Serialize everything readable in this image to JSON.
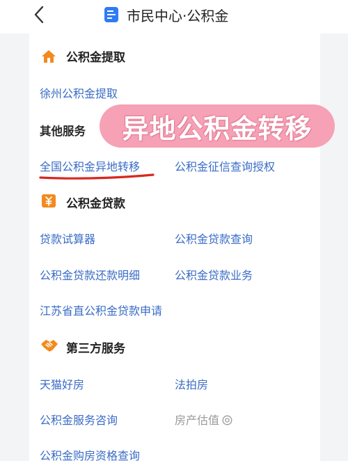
{
  "header": {
    "title": "市民中心·公积金",
    "back_icon": "chevron-left-icon",
    "app_icon": "document-icon"
  },
  "sections": {
    "withdraw": {
      "title": "公积金提取",
      "icon": "house-icon",
      "items": [
        "徐州公积金提取"
      ]
    },
    "other": {
      "title": "其他服务",
      "items": [
        "全国公积金异地转移",
        "公积金征信查询授权"
      ]
    },
    "loan": {
      "title": "公积金贷款",
      "icon": "money-icon",
      "items": [
        "贷款试算器",
        "公积金贷款查询",
        "公积金贷款还款明细",
        "公积金贷款业务",
        "江苏省直公积金贷款申请"
      ]
    },
    "third": {
      "title": "第三方服务",
      "icon": "handshake-icon",
      "items": [
        "天猫好房",
        "法拍房",
        "公积金服务咨询",
        "房产估值",
        "公积金购房资格查询"
      ]
    }
  },
  "overlay": {
    "sticker_text": "异地公积金转移",
    "sticker_color": "#f6a1b5",
    "underline_color": "#d8281e"
  },
  "colors": {
    "link": "#3a6cc6",
    "accent": "#f28a1e",
    "muted": "#999999"
  }
}
